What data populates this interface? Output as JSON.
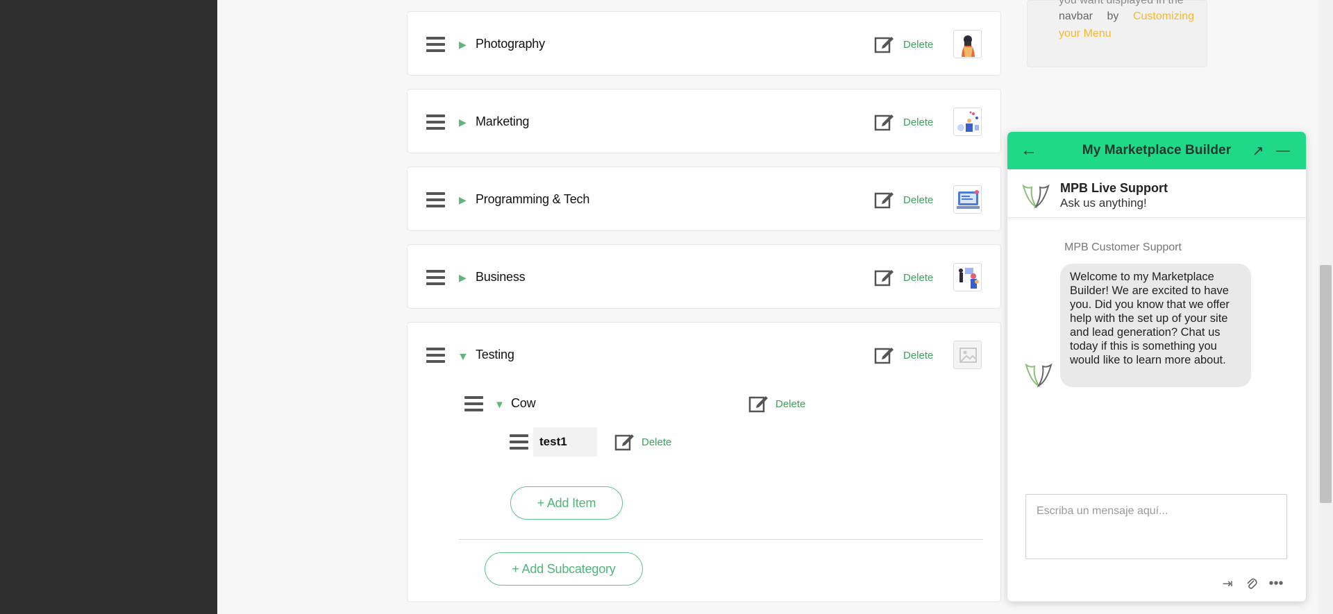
{
  "categories": [
    {
      "title": "Photography",
      "delete": "Delete"
    },
    {
      "title": "Marketing",
      "delete": "Delete"
    },
    {
      "title": "Programming & Tech",
      "delete": "Delete"
    },
    {
      "title": "Business",
      "delete": "Delete"
    },
    {
      "title": "Testing",
      "delete": "Delete"
    }
  ],
  "subcategory": {
    "title": "Cow",
    "delete": "Delete"
  },
  "item": {
    "value": "test1",
    "delete": "Delete"
  },
  "buttons": {
    "add_item": "+ Add Item",
    "add_subcategory": "+ Add Subcategory"
  },
  "info_card": {
    "line_cut": "you want displayed in the",
    "line_text": "navbar by ",
    "link_text": "Customizing your Menu"
  },
  "chat": {
    "title": "My Marketplace Builder",
    "agent_name": "MPB Live Support",
    "agent_subtitle": "Ask us anything!",
    "sender": "MPB Customer Support",
    "message": "Welcome to my Marketplace Builder! We are excited to have you. Did you know that we offer help with the set up of your site and lead generation? Chat us today if this is something you would like to learn more about.",
    "input_placeholder": "Escriba un mensaje aquí...",
    "icons": [
      "back-arrow-icon",
      "expand-icon",
      "minimize-icon",
      "exit-icon",
      "attach-icon",
      "more-icon"
    ]
  },
  "colors": {
    "accent_green": "#1fd989",
    "delete_green": "#3aa25c",
    "link_orange": "#f5b731"
  }
}
